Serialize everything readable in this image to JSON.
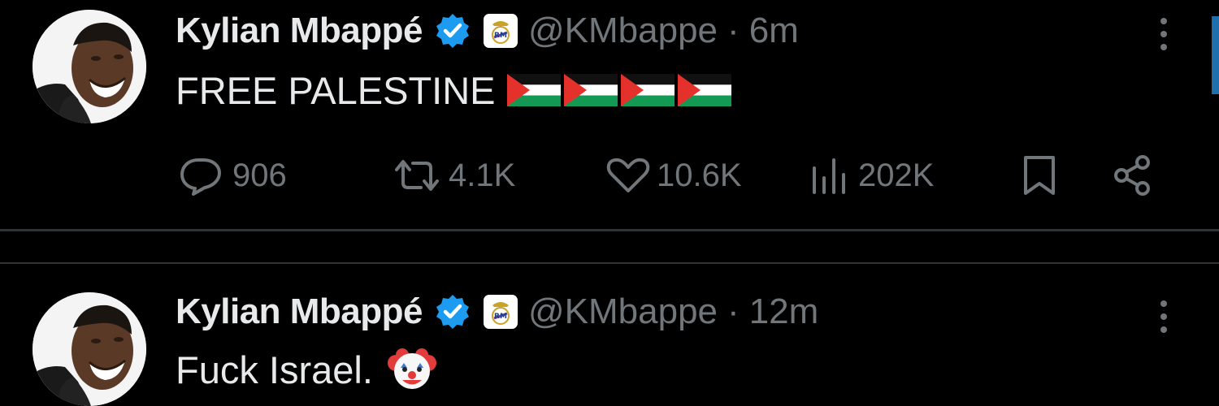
{
  "colors": {
    "background": "#000000",
    "primary_text": "#e7e9ea",
    "secondary_text": "#71767b",
    "verified_blue": "#1d9bf0",
    "divider": "#2f3336"
  },
  "tweets": [
    {
      "author": {
        "display_name": "Kylian Mbappé",
        "handle": "@KMbappe",
        "verified_icon": "verified-badge-icon",
        "affiliate_icon": "real-madrid-crest-icon"
      },
      "separator": "·",
      "time": "6m",
      "text": "FREE PALESTINE",
      "emoji": [
        "palestine-flag",
        "palestine-flag",
        "palestine-flag",
        "palestine-flag"
      ],
      "actions": {
        "replies": "906",
        "retweets": "4.1K",
        "likes": "10.6K",
        "views": "202K"
      }
    },
    {
      "author": {
        "display_name": "Kylian Mbappé",
        "handle": "@KMbappe",
        "verified_icon": "verified-badge-icon",
        "affiliate_icon": "real-madrid-crest-icon"
      },
      "separator": "·",
      "time": "12m",
      "text": "Fuck Israel.",
      "emoji": [
        "clown-face"
      ]
    }
  ]
}
